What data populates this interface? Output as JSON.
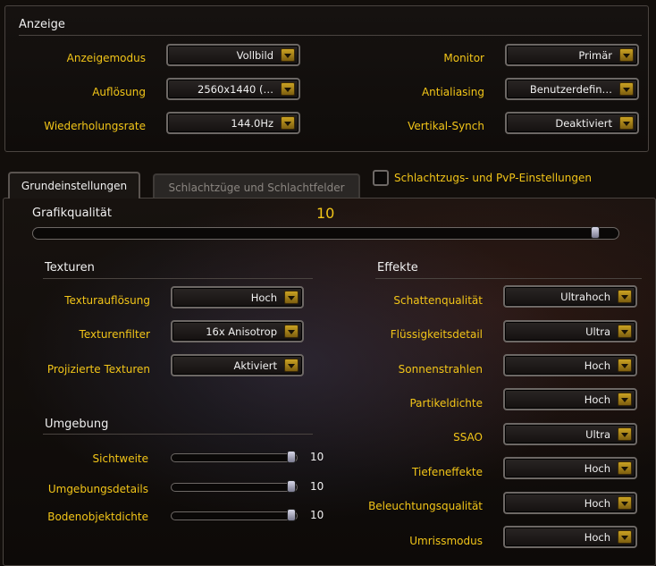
{
  "display": {
    "title": "Anzeige",
    "rows": [
      {
        "label": "Anzeigemodus",
        "value": "Vollbild"
      },
      {
        "label": "Auflösung",
        "value": "2560x1440 (…"
      },
      {
        "label": "Wiederholungsrate",
        "value": "144.0Hz"
      },
      {
        "label": "Monitor",
        "value": "Primär"
      },
      {
        "label": "Antialiasing",
        "value": "Benutzerdefin…"
      },
      {
        "label": "Vertikal-Synch",
        "value": "Deaktiviert"
      }
    ]
  },
  "tabs": [
    {
      "label": "Grundeinstellungen",
      "active": true
    },
    {
      "label": "Schlachtzüge und Schlachtfelder",
      "active": false
    }
  ],
  "pvp_checkbox": {
    "label": "Schlachtzugs- und PvP-Einstellungen",
    "checked": false
  },
  "quality": {
    "label": "Grafikqualität",
    "value": "10",
    "fraction": 1.0
  },
  "textures": {
    "title": "Texturen",
    "rows": [
      {
        "label": "Texturauflösung",
        "value": "Hoch"
      },
      {
        "label": "Texturenfilter",
        "value": "16x Anisotrop"
      },
      {
        "label": "Projizierte Texturen",
        "value": "Aktiviert"
      }
    ]
  },
  "environment": {
    "title": "Umgebung",
    "rows": [
      {
        "label": "Sichtweite",
        "value": "10",
        "fraction": 1.0
      },
      {
        "label": "Umgebungsdetails",
        "value": "10",
        "fraction": 1.0
      },
      {
        "label": "Bodenobjektdichte",
        "value": "10",
        "fraction": 1.0
      }
    ]
  },
  "effects": {
    "title": "Effekte",
    "rows": [
      {
        "label": "Schattenqualität",
        "value": "Ultrahoch"
      },
      {
        "label": "Flüssigkeitsdetail",
        "value": "Ultra"
      },
      {
        "label": "Sonnenstrahlen",
        "value": "Hoch"
      },
      {
        "label": "Partikeldichte",
        "value": "Hoch"
      },
      {
        "label": "SSAO",
        "value": "Ultra"
      },
      {
        "label": "Tiefeneffekte",
        "value": "Hoch"
      },
      {
        "label": "Beleuchtungsqualität",
        "value": "Hoch"
      },
      {
        "label": "Umrissmodus",
        "value": "Hoch"
      }
    ]
  },
  "colors": {
    "accent": "#f2c518",
    "text": "#f0f0f0",
    "panel_border": "#4a4440"
  }
}
